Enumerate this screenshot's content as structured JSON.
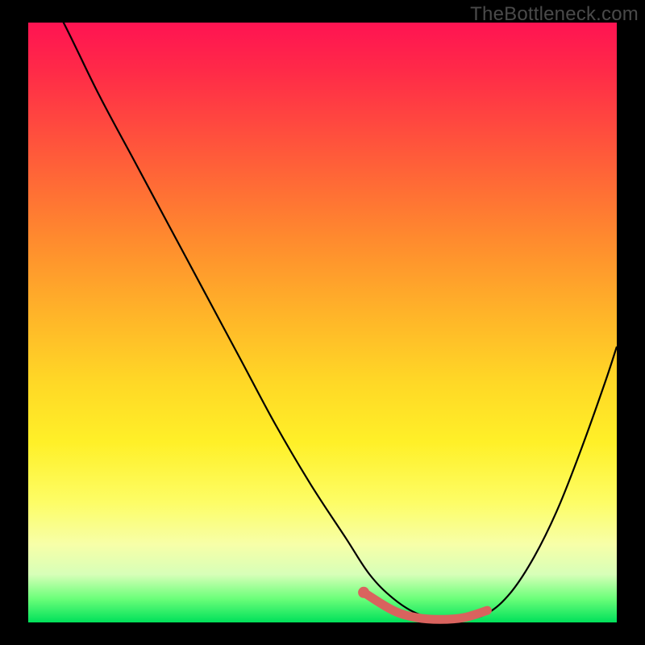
{
  "watermark": "TheBottleneck.com",
  "colors": {
    "background": "#000000",
    "gradient_top": "#ff1352",
    "gradient_bottom": "#00e05a",
    "curve": "#000000",
    "marker_line": "#d9635e",
    "marker_dot": "#d9635e"
  },
  "chart_data": {
    "type": "line",
    "title": "",
    "xlabel": "",
    "ylabel": "",
    "xlim": [
      0,
      100
    ],
    "ylim": [
      0,
      100
    ],
    "series": [
      {
        "name": "bottleneck-curve",
        "x": [
          0,
          6,
          12,
          18,
          24,
          30,
          36,
          42,
          48,
          54,
          58,
          62,
          66,
          70,
          74,
          78,
          82,
          86,
          90,
          94,
          98,
          100
        ],
        "y": [
          111,
          100,
          88,
          77,
          66,
          55,
          44,
          33,
          23,
          14,
          8,
          4,
          1.5,
          0.5,
          0.5,
          1.5,
          5,
          11,
          19,
          29,
          40,
          46
        ]
      }
    ],
    "highlight_segment": {
      "x": [
        57,
        62,
        66,
        70,
        74,
        78
      ],
      "y": [
        5,
        2,
        0.8,
        0.5,
        0.8,
        2
      ],
      "start_dot": {
        "x": 57,
        "y": 5
      }
    }
  }
}
